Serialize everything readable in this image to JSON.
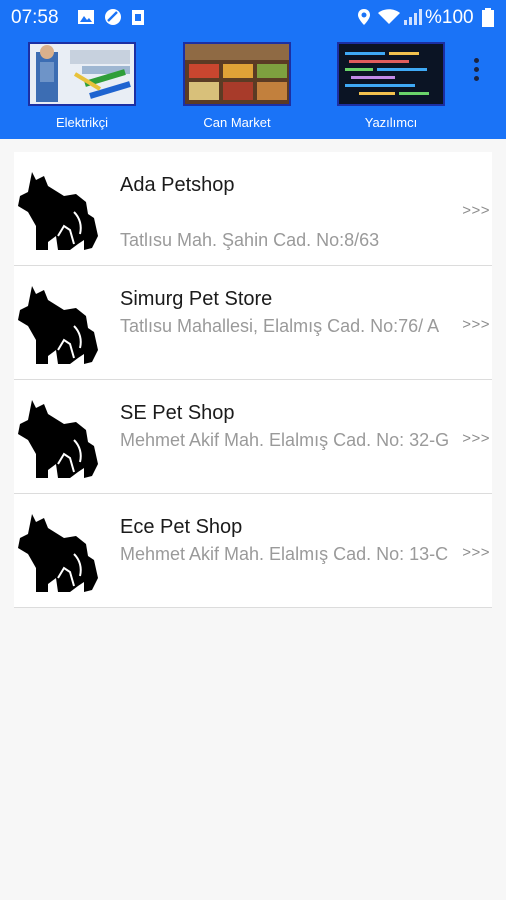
{
  "status": {
    "time": "07:58",
    "battery": "%100"
  },
  "categories": [
    {
      "label": "Elektrikçi",
      "icon": "electrician-thumbnail"
    },
    {
      "label": "Can Market",
      "icon": "market-thumbnail"
    },
    {
      "label": "Yazılımcı",
      "icon": "software-thumbnail"
    }
  ],
  "stores": [
    {
      "name": "Ada Petshop",
      "address": "Tatlısu Mah. Şahin Cad. No:8/63",
      "arrow": ">>>"
    },
    {
      "name": "Simurg Pet Store",
      "address": "Tatlısu Mahallesi, Elalmış Cad. No:76/ A",
      "arrow": ">>>"
    },
    {
      "name": "SE Pet Shop",
      "address": "Mehmet Akif Mah. Elalmış Cad. No: 32-G",
      "arrow": ">>>"
    },
    {
      "name": "Ece Pet Shop",
      "address": "Mehmet Akif Mah. Elalmış Cad. No: 13-C",
      "arrow": ">>>"
    }
  ],
  "colors": {
    "primary": "#1a73f7",
    "thumb_border": "#1c2fa3"
  }
}
